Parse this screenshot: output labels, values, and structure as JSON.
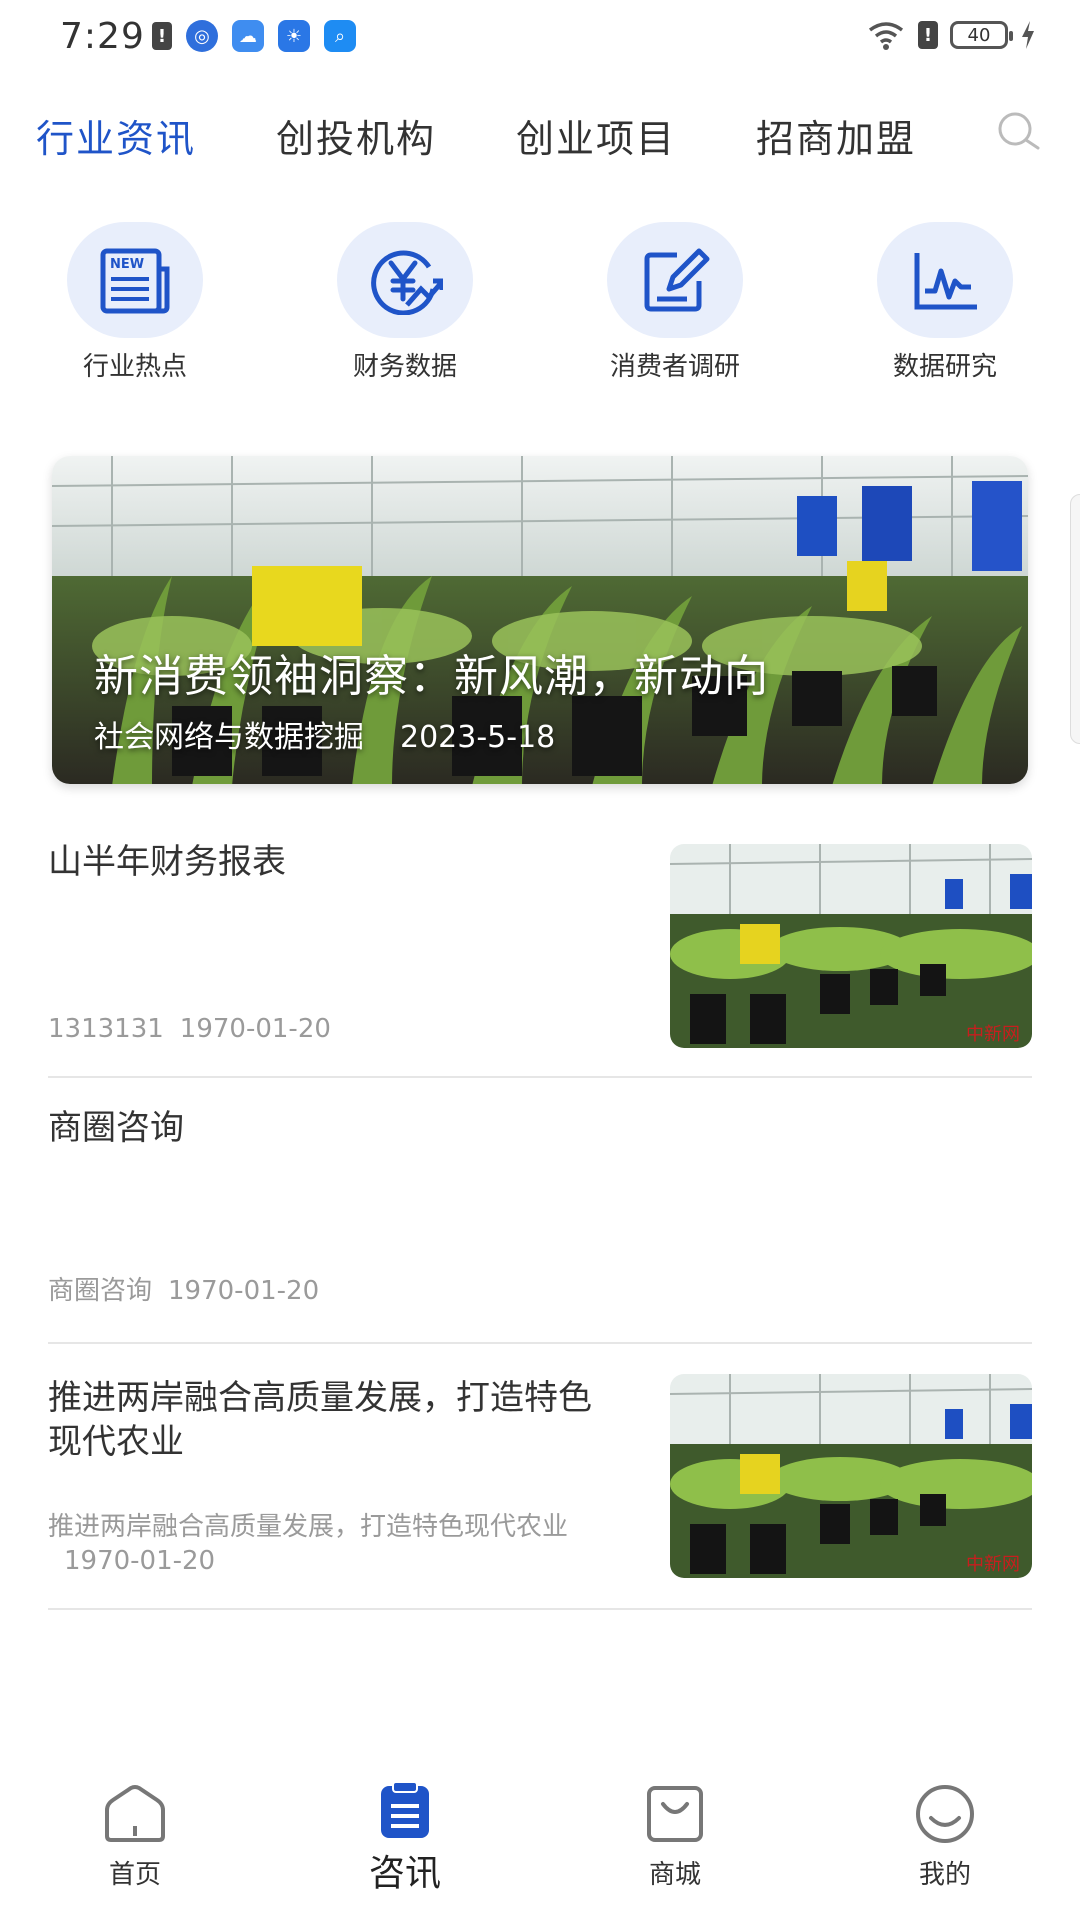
{
  "status_bar": {
    "time": "7:29",
    "battery": "40"
  },
  "tabs": [
    {
      "label": "行业资讯",
      "active": true
    },
    {
      "label": "创投机构",
      "active": false
    },
    {
      "label": "创业项目",
      "active": false
    },
    {
      "label": "招商加盟",
      "active": false
    }
  ],
  "categories": [
    {
      "label": "行业热点",
      "icon": "newspaper-icon"
    },
    {
      "label": "财务数据",
      "icon": "yen-chart-icon"
    },
    {
      "label": "消费者调研",
      "icon": "edit-note-icon"
    },
    {
      "label": "数据研究",
      "icon": "line-chart-icon"
    }
  ],
  "banner": {
    "title": "新消费领袖洞察：新风潮，新动向",
    "source": "社会网络与数据挖掘",
    "date": "2023-5-18"
  },
  "news": [
    {
      "title": "山半年财务报表",
      "source": "1313131",
      "date": "1970-01-20",
      "has_thumb": true
    },
    {
      "title": "商圈咨询",
      "source": "商圈咨询",
      "date": "1970-01-20",
      "has_thumb": false
    },
    {
      "title": "推进两岸融合高质量发展，打造特色现代农业",
      "source": "推进两岸融合高质量发展，打造特色现代农业",
      "date": "1970-01-20",
      "has_thumb": true
    }
  ],
  "thumb_watermark": "中新网",
  "bottom_nav": [
    {
      "label": "首页",
      "icon": "home-icon",
      "active": false
    },
    {
      "label": "咨讯",
      "icon": "clipboard-icon",
      "active": true
    },
    {
      "label": "商城",
      "icon": "shopping-bag-icon",
      "active": false
    },
    {
      "label": "我的",
      "icon": "smile-icon",
      "active": false
    }
  ],
  "colors": {
    "accent": "#1f54c8",
    "icon_bg": "#e8eefb"
  }
}
